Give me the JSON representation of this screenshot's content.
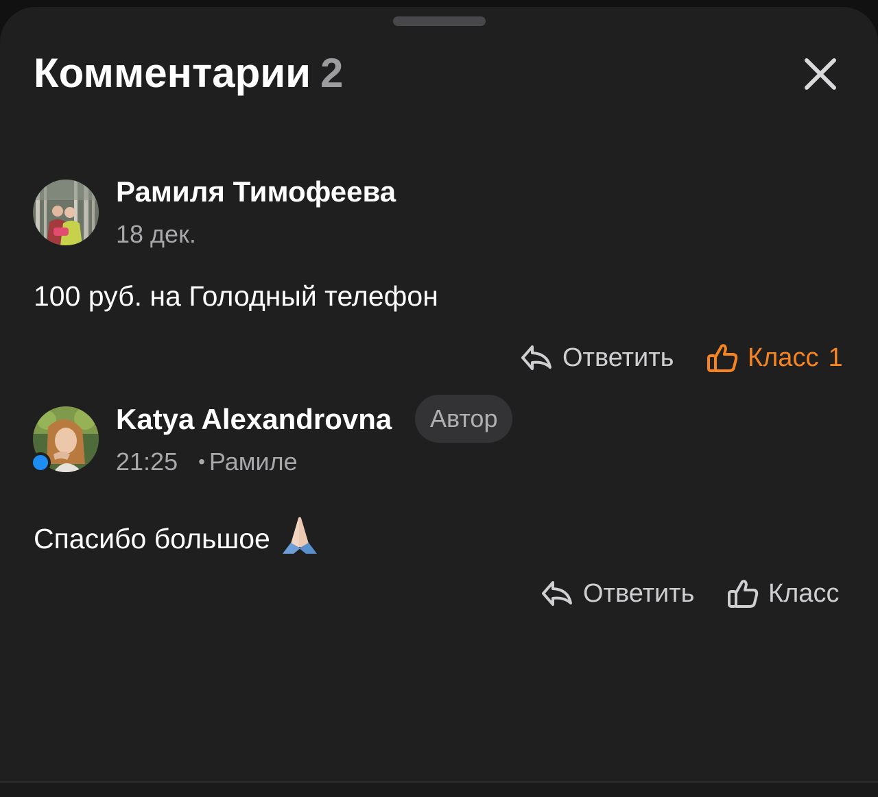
{
  "header": {
    "title": "Комментарии",
    "count": "2"
  },
  "comments": [
    {
      "author": "Рамиля Тимофеева",
      "date": "18 дек.",
      "text": "100 руб. на Голодный телефон",
      "reply_label": "Ответить",
      "like_label": "Класс",
      "like_count": "1",
      "liked": true
    },
    {
      "author": "Katya Alexandrovna",
      "badge": "Автор",
      "time": "21:25",
      "separator": "•",
      "reply_to": "Рамиле",
      "text": "Спасибо большое",
      "emoji": "folded-hands-emoji",
      "reply_label": "Ответить",
      "like_label": "Класс",
      "online": true
    }
  ],
  "colors": {
    "background": "#1f1f20",
    "liked_accent": "#f7851f",
    "online_dot": "#1e8df2",
    "secondary_text": "#a8a8ab"
  }
}
